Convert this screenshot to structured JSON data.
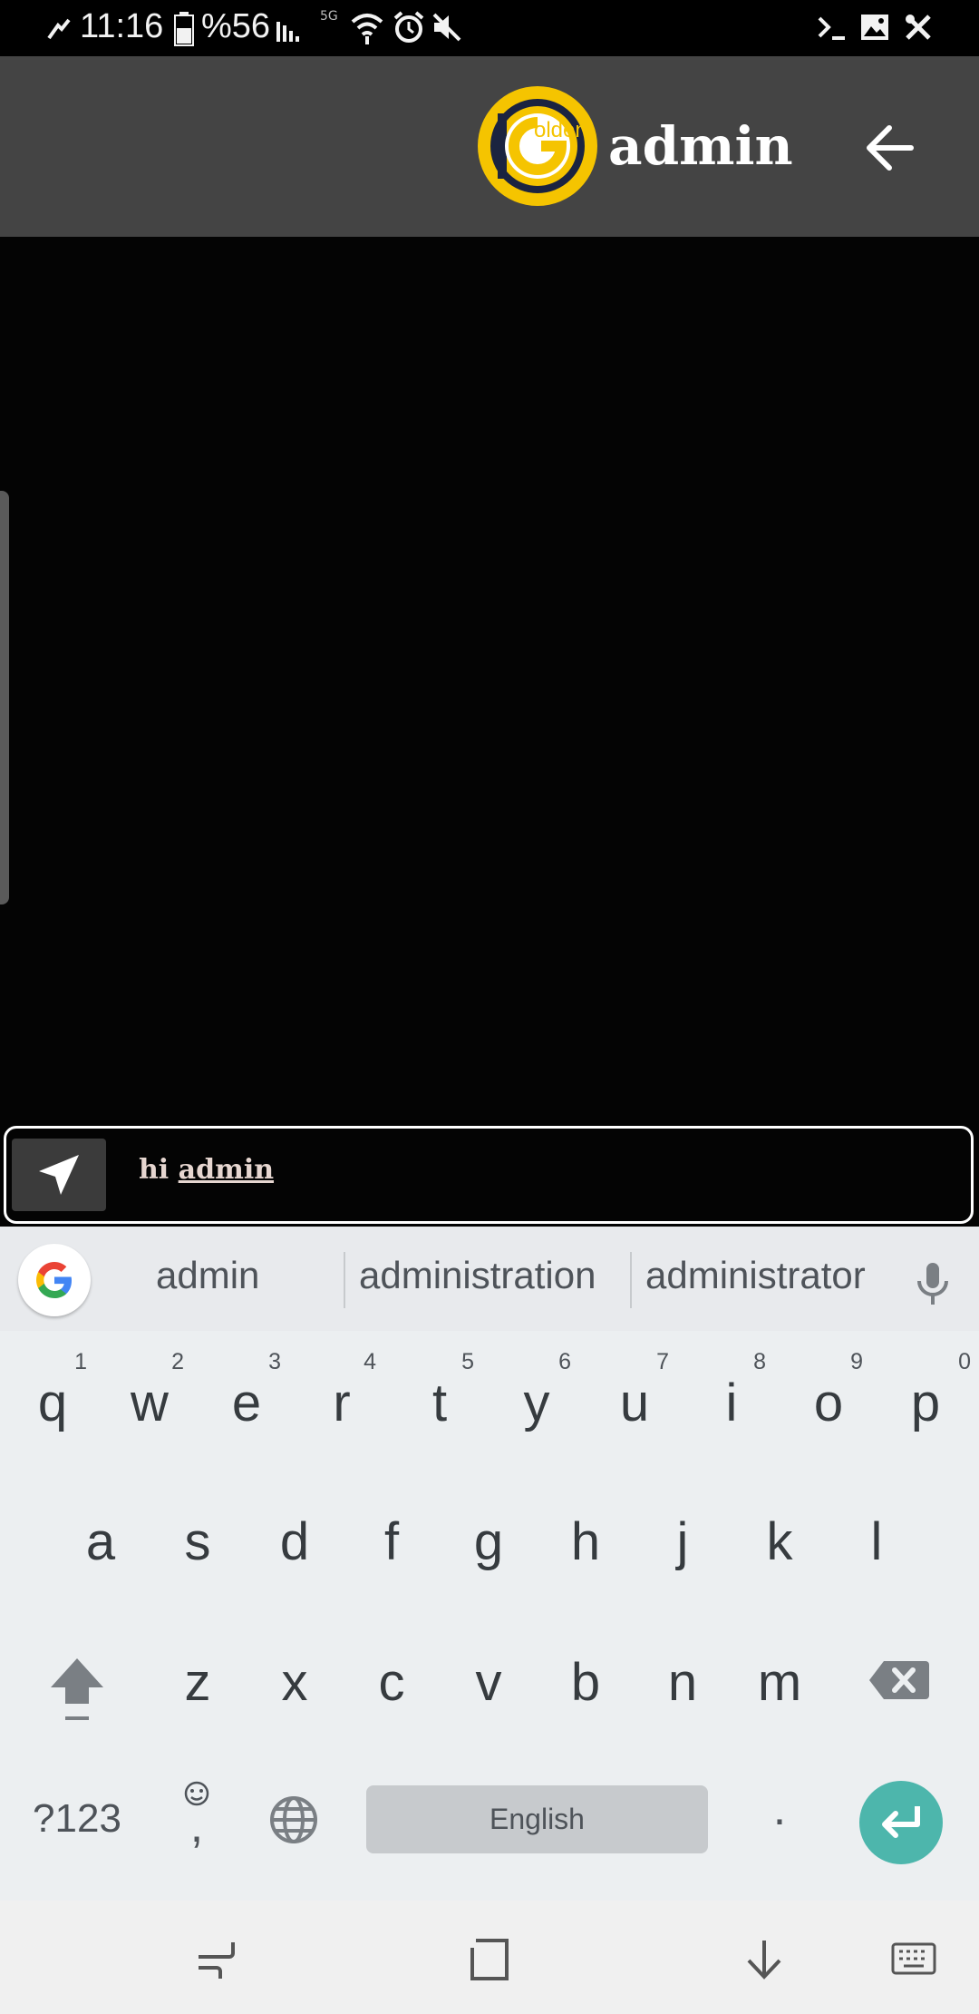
{
  "status_bar": {
    "time": "11:16",
    "battery": "%56",
    "network": "5G",
    "icons": [
      "signal-icon",
      "battery-icon",
      "wifi-icon",
      "alarm-icon",
      "mute-icon",
      "terminal-icon",
      "gallery-icon",
      "tools-icon"
    ]
  },
  "header": {
    "logo_text": "olden",
    "logo_letter": "G",
    "title": "admin",
    "back_icon": "arrow-left-icon"
  },
  "composer": {
    "send_icon": "send-icon",
    "text_plain": "hi ",
    "text_underlined": "admin"
  },
  "keyboard": {
    "suggestions": [
      "admin",
      "administration",
      "administrator"
    ],
    "row1": [
      {
        "k": "q",
        "n": "1"
      },
      {
        "k": "w",
        "n": "2"
      },
      {
        "k": "e",
        "n": "3"
      },
      {
        "k": "r",
        "n": "4"
      },
      {
        "k": "t",
        "n": "5"
      },
      {
        "k": "y",
        "n": "6"
      },
      {
        "k": "u",
        "n": "7"
      },
      {
        "k": "i",
        "n": "8"
      },
      {
        "k": "o",
        "n": "9"
      },
      {
        "k": "p",
        "n": "0"
      }
    ],
    "row2": [
      "a",
      "s",
      "d",
      "f",
      "g",
      "h",
      "j",
      "k",
      "l"
    ],
    "row3": [
      "z",
      "x",
      "c",
      "v",
      "b",
      "n",
      "m"
    ],
    "symbols_key": "?123",
    "comma_key": ",",
    "period_key": ".",
    "space_label": "English",
    "accent_color": "#4db6ac"
  },
  "nav_bar": {
    "icons": [
      "recents-icon",
      "home-icon",
      "hide-keyboard-icon",
      "keyboard-switch-icon"
    ]
  }
}
